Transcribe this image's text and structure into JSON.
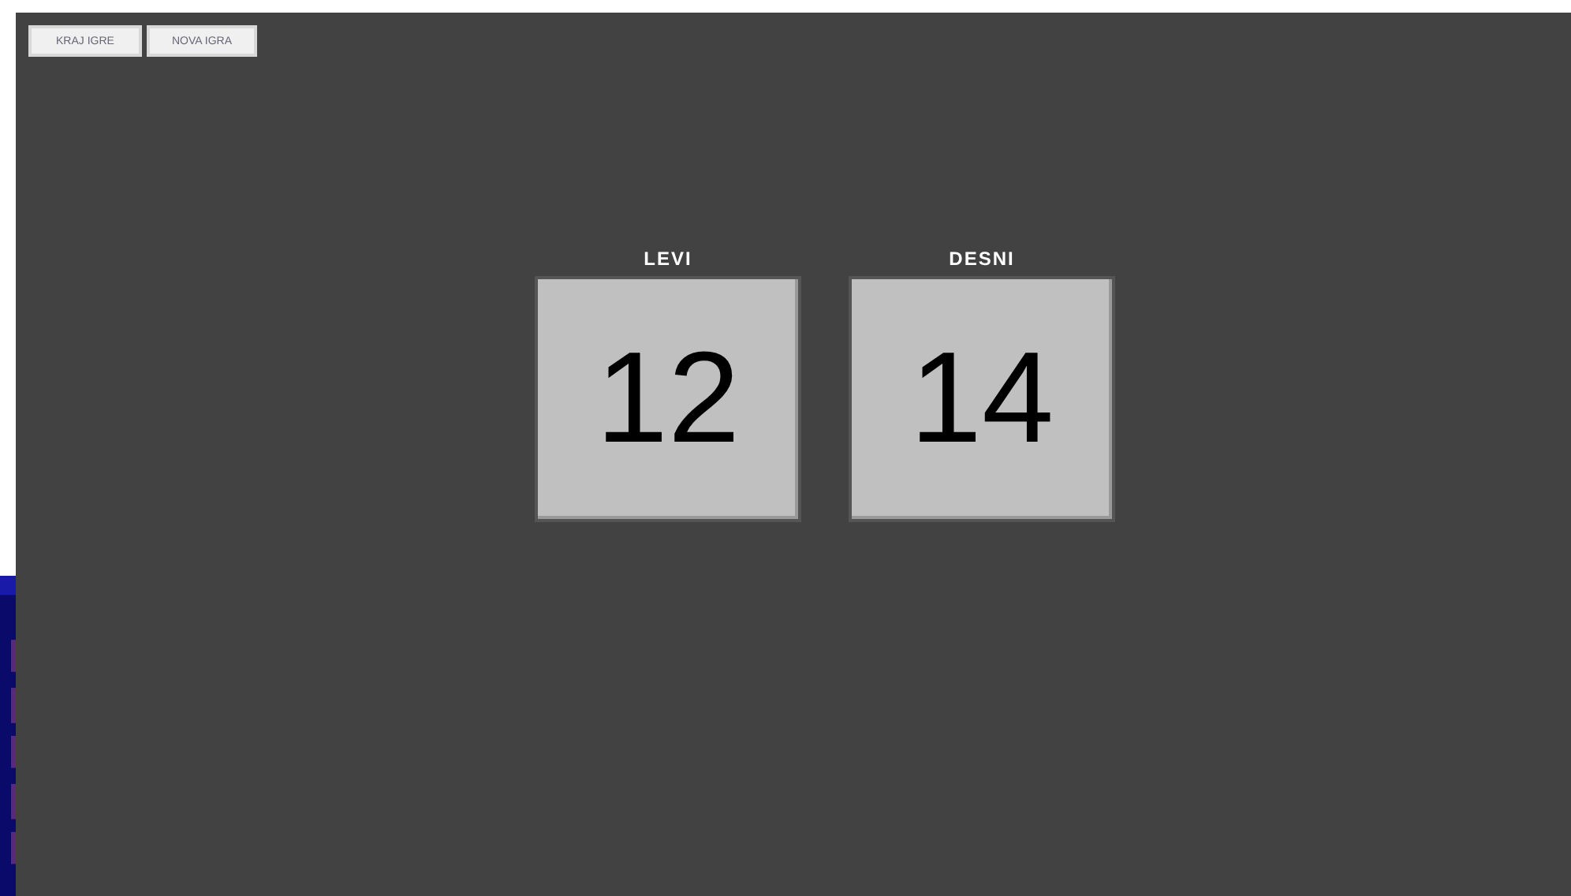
{
  "buttons": [
    "KRAJ IGRE",
    "NOVA IGRA"
  ],
  "scores": [
    {
      "label": "LEVI",
      "value": "12"
    },
    {
      "label": "DESNI",
      "value": "14"
    }
  ]
}
